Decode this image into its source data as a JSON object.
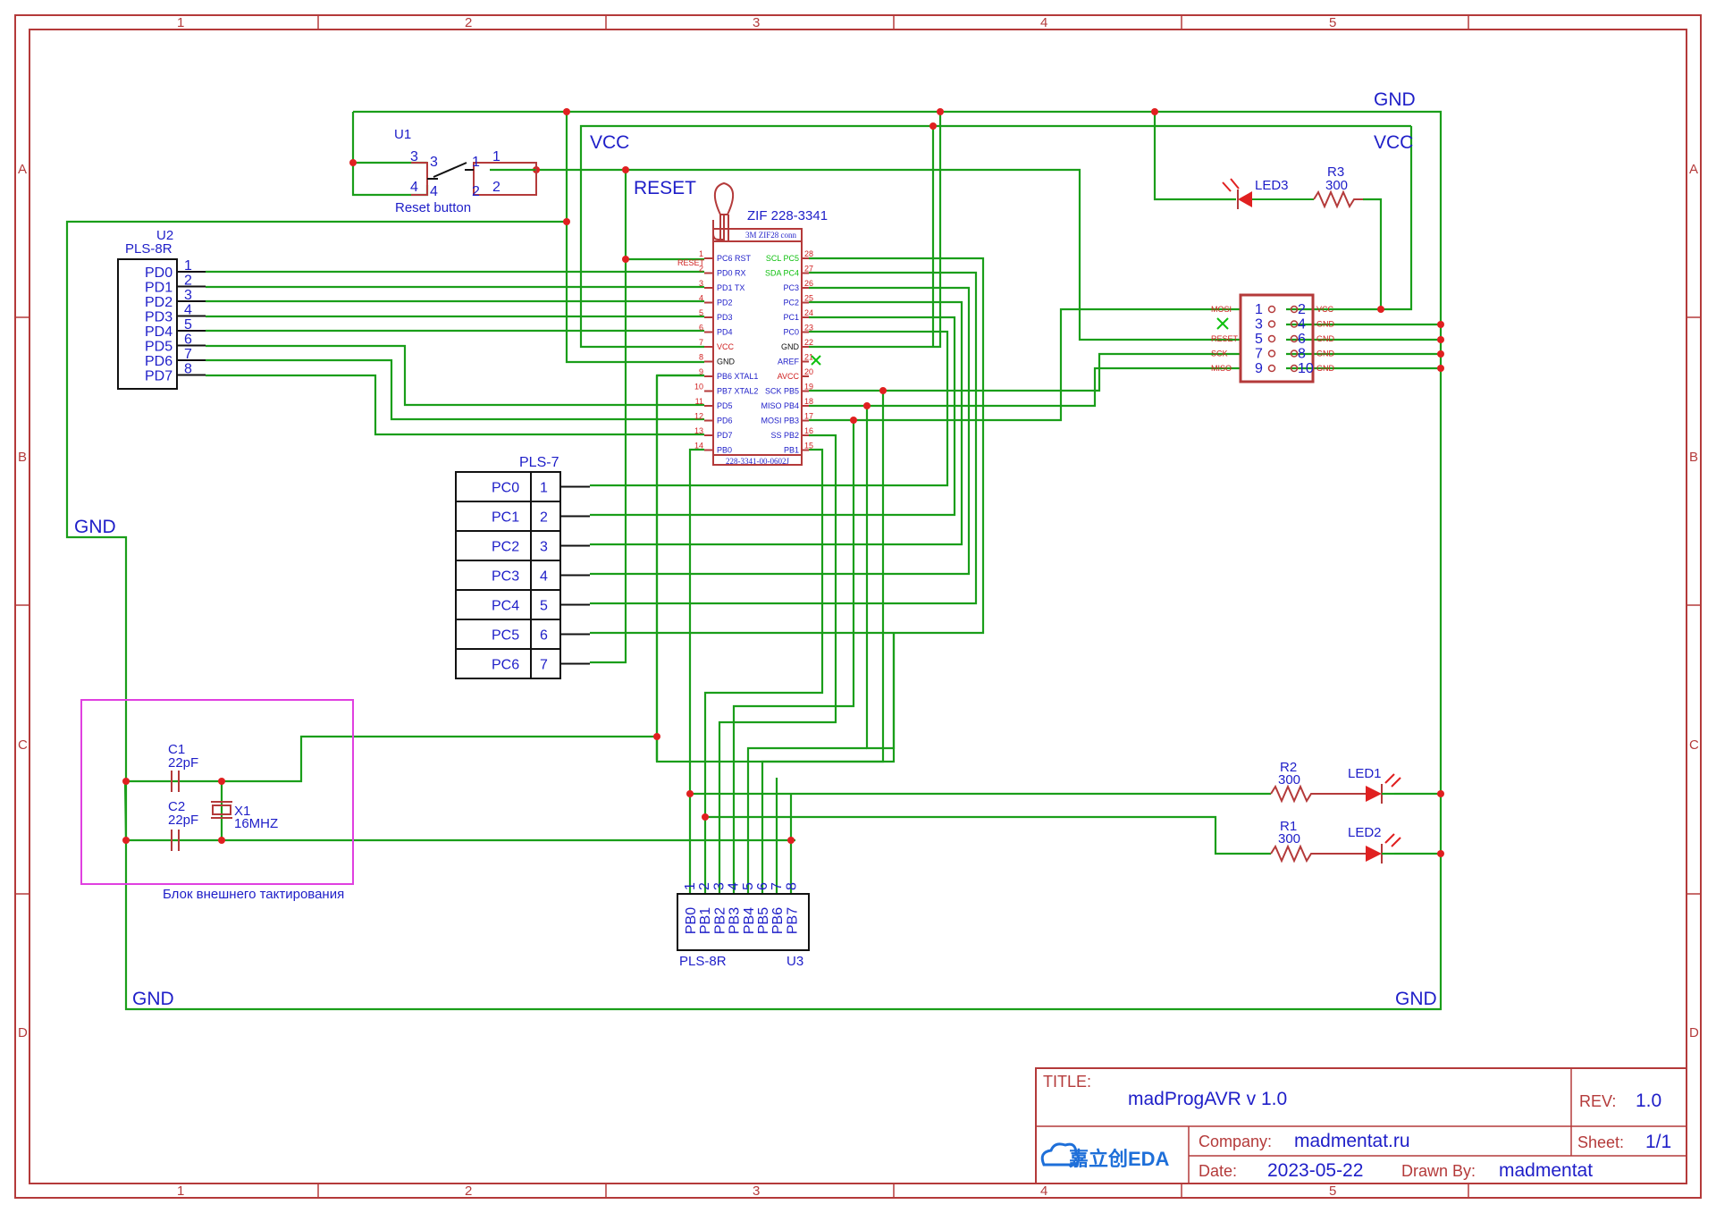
{
  "frame": {
    "columns": [
      "1",
      "2",
      "3",
      "4",
      "5"
    ],
    "rows": [
      "A",
      "B",
      "C",
      "D"
    ]
  },
  "title_block": {
    "title_label": "TITLE:",
    "title": "madProgAVR v 1.0",
    "rev_label": "REV:",
    "rev": "1.0",
    "company_label": "Company:",
    "company": "madmentat.ru",
    "sheet_label": "Sheet:",
    "sheet": "1/1",
    "date_label": "Date:",
    "date": "2023-05-22",
    "drawn_label": "Drawn By:",
    "drawn_by": "madmentat",
    "logo_text": "嘉立创EDA"
  },
  "nets": {
    "gnd": "GND",
    "vcc": "VCC",
    "reset": "RESET"
  },
  "u1": {
    "ref": "U1",
    "name": "Reset button",
    "pins": [
      "1",
      "2",
      "3",
      "4"
    ]
  },
  "u2": {
    "ref": "U2",
    "name": "PLS-8R",
    "pins": [
      "PD0",
      "PD1",
      "PD2",
      "PD3",
      "PD4",
      "PD5",
      "PD6",
      "PD7"
    ],
    "numbers": [
      "1",
      "2",
      "3",
      "4",
      "5",
      "6",
      "7",
      "8"
    ]
  },
  "pls7": {
    "name": "PLS-7",
    "pins": [
      "PC0",
      "PC1",
      "PC2",
      "PC3",
      "PC4",
      "PC5",
      "PC6"
    ],
    "numbers": [
      "1",
      "2",
      "3",
      "4",
      "5",
      "6",
      "7"
    ]
  },
  "u3": {
    "ref": "U3",
    "name": "PLS-8R",
    "pins": [
      "PB0",
      "PB1",
      "PB2",
      "PB3",
      "PB4",
      "PB5",
      "PB6",
      "PB7"
    ],
    "numbers": [
      "1",
      "2",
      "3",
      "4",
      "5",
      "6",
      "7",
      "8"
    ]
  },
  "zif": {
    "name": "ZIF 228-3341",
    "subtitle": "3M ZIF28 conn",
    "partno": "228-3341-00-0602J",
    "left_pins": [
      {
        "num": "1",
        "name": "PC6 RST",
        "color": "#1e1ec8"
      },
      {
        "num": "2",
        "name": "PD0 RX",
        "color": "#1e1ec8"
      },
      {
        "num": "3",
        "name": "PD1 TX",
        "color": "#1e1ec8"
      },
      {
        "num": "4",
        "name": "PD2",
        "color": "#1e1ec8"
      },
      {
        "num": "5",
        "name": "PD3",
        "color": "#1e1ec8"
      },
      {
        "num": "6",
        "name": "PD4",
        "color": "#1e1ec8"
      },
      {
        "num": "7",
        "name": "VCC",
        "color": "#d02020"
      },
      {
        "num": "8",
        "name": "GND",
        "color": "#111111"
      },
      {
        "num": "9",
        "name": "PB6 XTAL1",
        "color": "#1e1ec8"
      },
      {
        "num": "10",
        "name": "PB7 XTAL2",
        "color": "#1e1ec8"
      },
      {
        "num": "11",
        "name": "PD5",
        "color": "#1e1ec8"
      },
      {
        "num": "12",
        "name": "PD6",
        "color": "#1e1ec8"
      },
      {
        "num": "13",
        "name": "PD7",
        "color": "#1e1ec8"
      },
      {
        "num": "14",
        "name": "PB0",
        "color": "#1e1ec8"
      }
    ],
    "right_pins": [
      {
        "num": "28",
        "name": "SCL PC5",
        "color": "#10c010"
      },
      {
        "num": "27",
        "name": "SDA PC4",
        "color": "#10c010"
      },
      {
        "num": "26",
        "name": "PC3",
        "color": "#1e1ec8"
      },
      {
        "num": "25",
        "name": "PC2",
        "color": "#1e1ec8"
      },
      {
        "num": "24",
        "name": "PC1",
        "color": "#1e1ec8"
      },
      {
        "num": "23",
        "name": "PC0",
        "color": "#1e1ec8"
      },
      {
        "num": "22",
        "name": "GND",
        "color": "#111111"
      },
      {
        "num": "21",
        "name": "AREF",
        "color": "#1e1ec8"
      },
      {
        "num": "20",
        "name": "AVCC",
        "color": "#d02020"
      },
      {
        "num": "19",
        "name": "SCK PB5",
        "color": "#1e1ec8"
      },
      {
        "num": "18",
        "name": "MISO PB4",
        "color": "#1e1ec8"
      },
      {
        "num": "17",
        "name": "MOSI PB3",
        "color": "#1e1ec8"
      },
      {
        "num": "16",
        "name": "SS PB2",
        "color": "#1e1ec8"
      },
      {
        "num": "15",
        "name": "PB1",
        "color": "#1e1ec8"
      }
    ],
    "reset_tag": "RESET"
  },
  "isp": {
    "left_labels": [
      "MOSI",
      "",
      "RESET",
      "SCK",
      "MISO"
    ],
    "right_labels": [
      "VCC",
      "GND",
      "GND",
      "GND",
      "GND"
    ],
    "odd_numbers": [
      "1",
      "3",
      "5",
      "7",
      "9"
    ],
    "even_numbers": [
      "2",
      "4",
      "6",
      "8",
      "10"
    ]
  },
  "components": {
    "led3": "LED3",
    "r3_ref": "R3",
    "r3_val": "300",
    "r2_ref": "R2",
    "r2_val": "300",
    "r1_ref": "R1",
    "r1_val": "300",
    "led1": "LED1",
    "led2": "LED2",
    "c1_ref": "C1",
    "c1_val": "22pF",
    "c2_ref": "C2",
    "c2_val": "22pF",
    "x1_ref": "X1",
    "x1_val": "16MHZ",
    "clock_block": "Блок внешнего тактирования"
  },
  "colors": {
    "wire": "#1a9e1a",
    "frame": "#b43a3a",
    "label": "#1e1ec8",
    "junction": "#e02020",
    "block": "#e040e0"
  }
}
